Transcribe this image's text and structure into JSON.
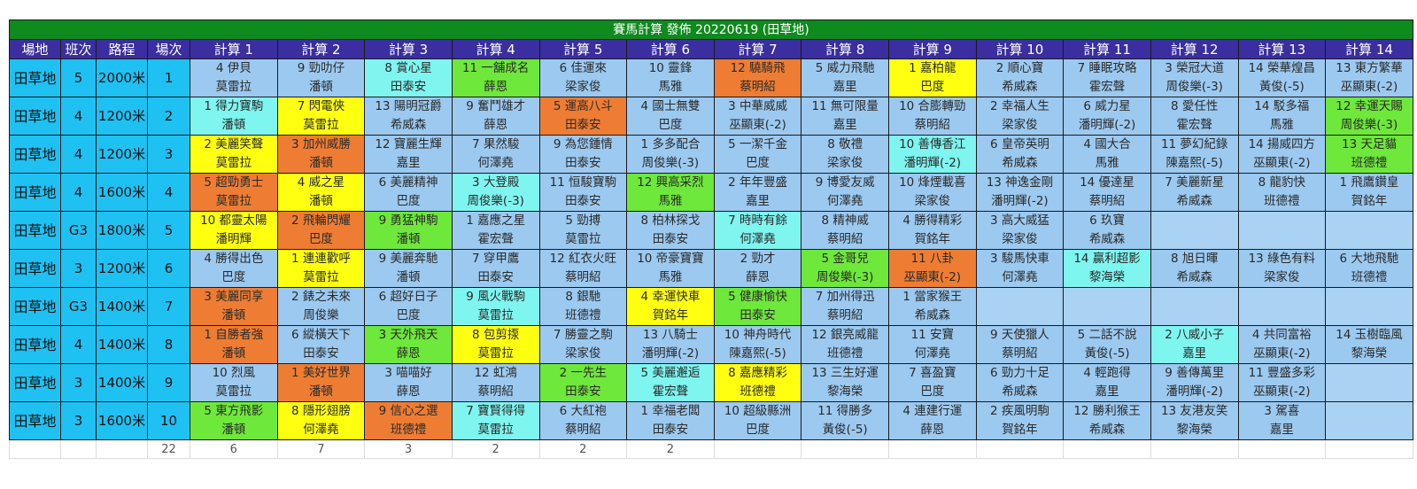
{
  "title": "賽馬計算 發佈 20220619 (田草地)",
  "headers": [
    "場地",
    "班次",
    "路程",
    "場次",
    "計算 1",
    "計算 2",
    "計算 3",
    "計算 4",
    "計算 5",
    "計算 6",
    "計算 7",
    "計算 8",
    "計算 9",
    "計算 10",
    "計算 11",
    "計算 12",
    "計算 13",
    "計算 14"
  ],
  "colors": {
    "b": "#9cc9f0",
    "c": "#7ff5f0",
    "g": "#6ee83a",
    "y": "#ffff10",
    "o": "#ee7d33",
    "info": "#1ec1f2",
    "header": "#3a2ea0",
    "title": "#0f8a1e"
  },
  "rows": [
    {
      "venue": "田草地",
      "cls": "5",
      "dist": "2000米",
      "race": "1",
      "cells": [
        {
          "h": "4 伊貝",
          "j": "莫雷拉",
          "c": "b"
        },
        {
          "h": "9 勁叻仔",
          "j": "潘頓",
          "c": "b"
        },
        {
          "h": "8 賞心星",
          "j": "田泰安",
          "c": "c"
        },
        {
          "h": "11 一舖成名",
          "j": "薛恩",
          "c": "g"
        },
        {
          "h": "6 佳運來",
          "j": "梁家俊",
          "c": "b"
        },
        {
          "h": "10 靈鋒",
          "j": "馬雅",
          "c": "b"
        },
        {
          "h": "12 驍騎飛",
          "j": "蔡明紹",
          "c": "o"
        },
        {
          "h": "5 威力飛馳",
          "j": "嘉里",
          "c": "b"
        },
        {
          "h": "1 嘉柏龍",
          "j": "巴度",
          "c": "y"
        },
        {
          "h": "2 順心寶",
          "j": "希威森",
          "c": "b"
        },
        {
          "h": "7 睡眠攻略",
          "j": "霍宏聲",
          "c": "b"
        },
        {
          "h": "3 榮冠大道",
          "j": "周俊樂(-3)",
          "c": "b"
        },
        {
          "h": "14 榮華煌昌",
          "j": "黃俊(-5)",
          "c": "b"
        },
        {
          "h": "13 東方繁華",
          "j": "巫顯東(-2)",
          "c": "b"
        }
      ]
    },
    {
      "venue": "田草地",
      "cls": "4",
      "dist": "1200米",
      "race": "2",
      "cells": [
        {
          "h": "1 得力寶駒",
          "j": "潘頓",
          "c": "c"
        },
        {
          "h": "7 閃電俠",
          "j": "莫雷拉",
          "c": "y"
        },
        {
          "h": "13 陽明冠爵",
          "j": "希威森",
          "c": "b"
        },
        {
          "h": "9 奮鬥雄才",
          "j": "薛恩",
          "c": "b"
        },
        {
          "h": "5 運高八斗",
          "j": "田泰安",
          "c": "o"
        },
        {
          "h": "4 國士無雙",
          "j": "巴度",
          "c": "b"
        },
        {
          "h": "3 中華威威",
          "j": "巫顯東(-2)",
          "c": "b"
        },
        {
          "h": "11 無可限量",
          "j": "嘉里",
          "c": "b"
        },
        {
          "h": "10 合膨轉勁",
          "j": "蔡明紹",
          "c": "b"
        },
        {
          "h": "2 幸福人生",
          "j": "梁家俊",
          "c": "b"
        },
        {
          "h": "6 威力星",
          "j": "潘明輝(-2)",
          "c": "b"
        },
        {
          "h": "8 愛任性",
          "j": "霍宏聲",
          "c": "b"
        },
        {
          "h": "14 駁多福",
          "j": "馬雅",
          "c": "b"
        },
        {
          "h": "12 幸運天賜",
          "j": "周俊樂(-3)",
          "c": "g"
        }
      ]
    },
    {
      "venue": "田草地",
      "cls": "4",
      "dist": "1200米",
      "race": "3",
      "cells": [
        {
          "h": "2 美麗笑聲",
          "j": "莫雷拉",
          "c": "y"
        },
        {
          "h": "3 加州威勝",
          "j": "潘頓",
          "c": "o"
        },
        {
          "h": "12 寶麗生輝",
          "j": "嘉里",
          "c": "b"
        },
        {
          "h": "7 果然駿",
          "j": "何澤堯",
          "c": "b"
        },
        {
          "h": "9 為您鍾情",
          "j": "田泰安",
          "c": "b"
        },
        {
          "h": "1 多多配合",
          "j": "周俊樂(-3)",
          "c": "b"
        },
        {
          "h": "5 一潔千金",
          "j": "巴度",
          "c": "b"
        },
        {
          "h": "8 敬禮",
          "j": "梁家俊",
          "c": "b"
        },
        {
          "h": "10 善傳香江",
          "j": "潘明輝(-2)",
          "c": "c"
        },
        {
          "h": "6 皇帝英明",
          "j": "希威森",
          "c": "b"
        },
        {
          "h": "4 國大合",
          "j": "馬雅",
          "c": "b"
        },
        {
          "h": "11 夢幻紀錄",
          "j": "陳嘉熙(-5)",
          "c": "b"
        },
        {
          "h": "14 揚威四方",
          "j": "巫顯東(-2)",
          "c": "b"
        },
        {
          "h": "13 天足貓",
          "j": "班德禮",
          "c": "g"
        }
      ]
    },
    {
      "venue": "田草地",
      "cls": "4",
      "dist": "1600米",
      "race": "4",
      "cells": [
        {
          "h": "5 超勁勇士",
          "j": "莫雷拉",
          "c": "o"
        },
        {
          "h": "4 威之星",
          "j": "潘頓",
          "c": "y"
        },
        {
          "h": "6 美麗精神",
          "j": "巴度",
          "c": "b"
        },
        {
          "h": "3 大登殿",
          "j": "周俊樂(-3)",
          "c": "c"
        },
        {
          "h": "11 恒駿寶駒",
          "j": "田泰安",
          "c": "b"
        },
        {
          "h": "12 興高采烈",
          "j": "馬雅",
          "c": "g"
        },
        {
          "h": "2 年年豐盛",
          "j": "嘉里",
          "c": "b"
        },
        {
          "h": "9 博愛友威",
          "j": "何澤堯",
          "c": "b"
        },
        {
          "h": "10 烽煙載喜",
          "j": "梁家俊",
          "c": "b"
        },
        {
          "h": "13 神逸金剛",
          "j": "潘明輝(-2)",
          "c": "b"
        },
        {
          "h": "14 優達星",
          "j": "蔡明紹",
          "c": "b"
        },
        {
          "h": "7 美麗新星",
          "j": "希威森",
          "c": "b"
        },
        {
          "h": "8 龍豹快",
          "j": "班德禮",
          "c": "b"
        },
        {
          "h": "1 飛鷹鑽皇",
          "j": "賀銘年",
          "c": "b"
        }
      ]
    },
    {
      "venue": "田草地",
      "cls": "G3",
      "dist": "1800米",
      "race": "5",
      "cells": [
        {
          "h": "10 都靈太陽",
          "j": "潘明輝",
          "c": "y"
        },
        {
          "h": "2 飛輪閃耀",
          "j": "巴度",
          "c": "o"
        },
        {
          "h": "9 勇猛神駒",
          "j": "潘頓",
          "c": "g"
        },
        {
          "h": "1 嘉應之星",
          "j": "霍宏聲",
          "c": "b"
        },
        {
          "h": "5 勁搏",
          "j": "莫雷拉",
          "c": "b"
        },
        {
          "h": "8 柏林探戈",
          "j": "田泰安",
          "c": "b"
        },
        {
          "h": "7 時時有餘",
          "j": "何澤堯",
          "c": "c"
        },
        {
          "h": "8 精神威",
          "j": "蔡明紹",
          "c": "b"
        },
        {
          "h": "4 勝得精彩",
          "j": "賀銘年",
          "c": "b"
        },
        {
          "h": "3 高大威猛",
          "j": "梁家俊",
          "c": "b"
        },
        {
          "h": "6 玖寶",
          "j": "希威森",
          "c": "b"
        },
        {
          "h": "",
          "j": "",
          "c": "e"
        },
        {
          "h": "",
          "j": "",
          "c": "e"
        },
        {
          "h": "",
          "j": "",
          "c": "e"
        }
      ]
    },
    {
      "venue": "田草地",
      "cls": "3",
      "dist": "1200米",
      "race": "6",
      "cells": [
        {
          "h": "4 勝得出色",
          "j": "巴度",
          "c": "b"
        },
        {
          "h": "1 連連歡呼",
          "j": "莫雷拉",
          "c": "y"
        },
        {
          "h": "9 美麗奔馳",
          "j": "潘頓",
          "c": "b"
        },
        {
          "h": "7 穿甲鷹",
          "j": "田泰安",
          "c": "b"
        },
        {
          "h": "12 紅衣火旺",
          "j": "蔡明紹",
          "c": "b"
        },
        {
          "h": "10 帝豪寶寶",
          "j": "馬雅",
          "c": "b"
        },
        {
          "h": "2 勁才",
          "j": "薛恩",
          "c": "b"
        },
        {
          "h": "5 金哥兒",
          "j": "周俊樂(-3)",
          "c": "g"
        },
        {
          "h": "11 八卦",
          "j": "巫顯東(-2)",
          "c": "o"
        },
        {
          "h": "3 駿馬快車",
          "j": "何澤堯",
          "c": "b"
        },
        {
          "h": "14 贏利超影",
          "j": "黎海榮",
          "c": "c"
        },
        {
          "h": "8 旭日暉",
          "j": "希威森",
          "c": "b"
        },
        {
          "h": "13 綠色有料",
          "j": "梁家俊",
          "c": "b"
        },
        {
          "h": "6 大地飛馳",
          "j": "班德禮",
          "c": "b"
        }
      ]
    },
    {
      "venue": "田草地",
      "cls": "G3",
      "dist": "1400米",
      "race": "7",
      "cells": [
        {
          "h": "3 美麗同享",
          "j": "潘頓",
          "c": "o"
        },
        {
          "h": "2 錶之未來",
          "j": "周俊樂",
          "c": "b"
        },
        {
          "h": "6 超好日子",
          "j": "巴度",
          "c": "b"
        },
        {
          "h": "9 風火戰駒",
          "j": "莫雷拉",
          "c": "c"
        },
        {
          "h": "8 銀馳",
          "j": "班德禮",
          "c": "b"
        },
        {
          "h": "4 幸運快車",
          "j": "賀銘年",
          "c": "y"
        },
        {
          "h": "5 健康愉快",
          "j": "田泰安",
          "c": "g"
        },
        {
          "h": "7 加州得迅",
          "j": "蔡明紹",
          "c": "b"
        },
        {
          "h": "1 當家猴王",
          "j": "希威森",
          "c": "b"
        },
        {
          "h": "",
          "j": "",
          "c": "e"
        },
        {
          "h": "",
          "j": "",
          "c": "e"
        },
        {
          "h": "",
          "j": "",
          "c": "e"
        },
        {
          "h": "",
          "j": "",
          "c": "e"
        },
        {
          "h": "",
          "j": "",
          "c": "e"
        }
      ]
    },
    {
      "venue": "田草地",
      "cls": "4",
      "dist": "1400米",
      "race": "8",
      "cells": [
        {
          "h": "1 自勝者強",
          "j": "潘頓",
          "c": "o"
        },
        {
          "h": "6 縱橫天下",
          "j": "田泰安",
          "c": "b"
        },
        {
          "h": "3 天外飛天",
          "j": "薛恩",
          "c": "g"
        },
        {
          "h": "8 包剪揼",
          "j": "莫雷拉",
          "c": "y"
        },
        {
          "h": "7 勝靈之駒",
          "j": "梁家俊",
          "c": "b"
        },
        {
          "h": "13 八騎士",
          "j": "潘明輝(-2)",
          "c": "b"
        },
        {
          "h": "10 神舟時代",
          "j": "陳嘉熙(-5)",
          "c": "b"
        },
        {
          "h": "12 銀亮威龍",
          "j": "班德禮",
          "c": "b"
        },
        {
          "h": "11 安寶",
          "j": "何澤堯",
          "c": "b"
        },
        {
          "h": "9 天使獵人",
          "j": "蔡明紹",
          "c": "b"
        },
        {
          "h": "5 二話不說",
          "j": "黃俊(-5)",
          "c": "b"
        },
        {
          "h": "2 八威小子",
          "j": "嘉里",
          "c": "c"
        },
        {
          "h": "4 共同富裕",
          "j": "巫顯東(-2)",
          "c": "b"
        },
        {
          "h": "14 玉樹臨風",
          "j": "黎海榮",
          "c": "b"
        }
      ]
    },
    {
      "venue": "田草地",
      "cls": "3",
      "dist": "1400米",
      "race": "9",
      "cells": [
        {
          "h": "10 烈風",
          "j": "莫雷拉",
          "c": "b"
        },
        {
          "h": "1 美好世界",
          "j": "潘頓",
          "c": "o"
        },
        {
          "h": "3 喵喵好",
          "j": "薛恩",
          "c": "b"
        },
        {
          "h": "12 虹鴻",
          "j": "蔡明紹",
          "c": "b"
        },
        {
          "h": "2 一先生",
          "j": "田泰安",
          "c": "g"
        },
        {
          "h": "5 美麗邂逅",
          "j": "霍宏聲",
          "c": "c"
        },
        {
          "h": "8 嘉應精彩",
          "j": "班德禮",
          "c": "y"
        },
        {
          "h": "13 三生好運",
          "j": "黎海榮",
          "c": "b"
        },
        {
          "h": "7 喜盈寶",
          "j": "巴度",
          "c": "b"
        },
        {
          "h": "6 勁力十足",
          "j": "希威森",
          "c": "b"
        },
        {
          "h": "4 輕跑得",
          "j": "嘉里",
          "c": "b"
        },
        {
          "h": "9 善傳萬里",
          "j": "潘明輝(-2)",
          "c": "b"
        },
        {
          "h": "11 豐盛多彩",
          "j": "巫顯東(-2)",
          "c": "b"
        },
        {
          "h": "",
          "j": "",
          "c": "e"
        }
      ]
    },
    {
      "venue": "田草地",
      "cls": "3",
      "dist": "1600米",
      "race": "10",
      "cells": [
        {
          "h": "5 東方飛影",
          "j": "潘頓",
          "c": "g"
        },
        {
          "h": "8 隱形翅膀",
          "j": "何澤堯",
          "c": "y"
        },
        {
          "h": "9 信心之選",
          "j": "班德禮",
          "c": "o"
        },
        {
          "h": "7 寶賢得得",
          "j": "莫雷拉",
          "c": "c"
        },
        {
          "h": "6 大紅袍",
          "j": "蔡明紹",
          "c": "b"
        },
        {
          "h": "1 幸福老闆",
          "j": "田泰安",
          "c": "b"
        },
        {
          "h": "10 超級縣洲",
          "j": "巴度",
          "c": "b"
        },
        {
          "h": "11 得勝多",
          "j": "黃俊(-5)",
          "c": "b"
        },
        {
          "h": "4 連建行運",
          "j": "薛恩",
          "c": "b"
        },
        {
          "h": "2 疾風明駒",
          "j": "賀銘年",
          "c": "b"
        },
        {
          "h": "12 勝利猴王",
          "j": "希威森",
          "c": "b"
        },
        {
          "h": "13 友港友笑",
          "j": "黎海榮",
          "c": "b"
        },
        {
          "h": "3 駕喜",
          "j": "嘉里",
          "c": "b"
        },
        {
          "h": "",
          "j": "",
          "c": "e"
        }
      ]
    }
  ],
  "totals": [
    "",
    "",
    "",
    "22",
    "6",
    "7",
    "3",
    "2",
    "2",
    "2",
    "",
    "",
    "",
    "",
    "",
    "",
    "",
    ""
  ]
}
